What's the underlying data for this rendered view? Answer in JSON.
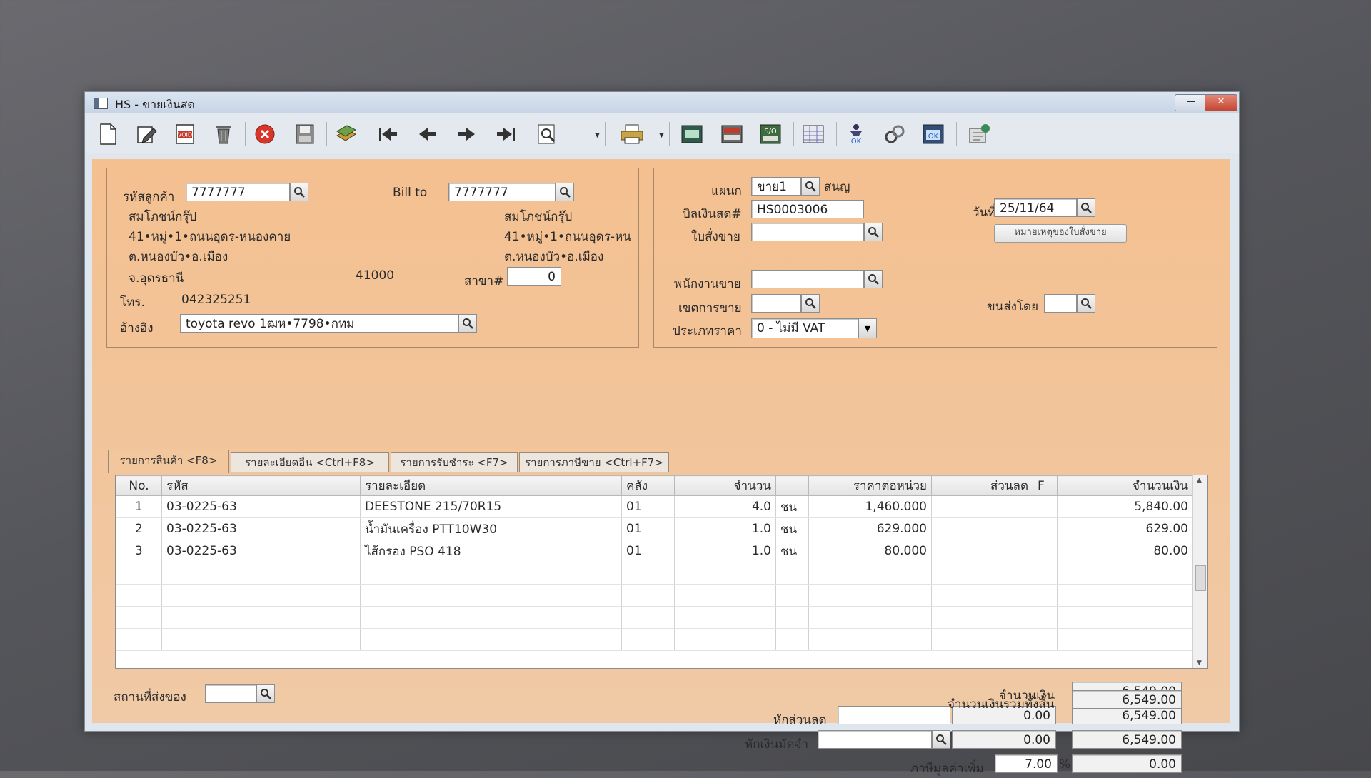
{
  "window": {
    "title": "HS - ขายเงินสด",
    "minimize": "—",
    "maximize": "□",
    "close": "✕"
  },
  "toolbar": {
    "icons": [
      "new-doc-icon",
      "edit-icon",
      "void-icon",
      "delete-trash-icon",
      "cancel-icon",
      "save-icon",
      "copy-icon",
      "first-record-icon",
      "previous-record-icon",
      "next-record-icon",
      "last-record-icon",
      "search-icon",
      "print-icon",
      "report-icon",
      "screen-icon",
      "calc-icon",
      "grid-icon",
      "approve-icon",
      "link-icon",
      "ok-icon",
      "export-icon"
    ]
  },
  "customer": {
    "code_label": "รหัสลูกค้า",
    "code_value": "7777777",
    "billto_label": "Bill to",
    "billto_value": "7777777",
    "name": "สมโภชน์กรุ๊ป",
    "addr1": "41•หมู่•1•ถนนอุดร-หนองคาย",
    "addr2": "ต.หนองบัว•อ.เมือง",
    "addr3": "จ.อุดรธานี",
    "postcode": "41000",
    "billto_name": "สมโภชน์กรุ๊ป",
    "billto_addr1": "41•หมู่•1•ถนนอุดร-หน",
    "billto_addr2": "ต.หนองบัว•อ.เมือง",
    "branch_label": "สาขา#",
    "branch_value": "0",
    "phone_label": "โทร.",
    "phone_value": "042325251",
    "ref_label": "อ้างอิง",
    "ref_value": "toyota revo 1ฒห•7798•กทม"
  },
  "doc": {
    "dept_label": "แผนก",
    "dept_value": "ขาย1",
    "dept_name": "สนญ",
    "bill_label": "บิลเงินสด#",
    "bill_value": "HS0003006",
    "date_label": "วันที่",
    "date_value": "25/11/64",
    "so_label": "ใบสั่งขาย",
    "so_value": "",
    "so_note_button": "หมายเหตุของใบสั่งขาย",
    "salesman_label": "พนักงานขาย",
    "salesman_value": "",
    "area_label": "เขตการขาย",
    "area_value": "",
    "shipby_label": "ขนส่งโดย",
    "shipby_value": "",
    "pricetype_label": "ประเภทราคา",
    "pricetype_value": "0 - ไม่มี VAT"
  },
  "tabs": [
    "รายการสินค้า <F8>",
    "รายละเอียดอื่น <Ctrl+F8>",
    "รายการรับชำระ <F7>",
    "รายการภาษีขาย <Ctrl+F7>"
  ],
  "grid": {
    "headers": [
      "No.",
      "รหัส",
      "รายละเอียด",
      "คลัง",
      "จำนวน",
      "",
      "ราคาต่อหน่วย",
      "ส่วนลด",
      "F",
      "จำนวนเงิน"
    ],
    "rows": [
      [
        "1",
        "03-0225-63",
        "DEESTONE 215/70R15",
        "01",
        "4.0",
        "ชน",
        "1,460.000",
        "",
        "",
        "5,840.00"
      ],
      [
        "2",
        "03-0225-63",
        "น้ำมันเครื่อง PTT10W30",
        "01",
        "1.0",
        "ชน",
        "629.000",
        "",
        "",
        "629.00"
      ],
      [
        "3",
        "03-0225-63",
        "ไส้กรอง PSO 418",
        "01",
        "1.0",
        "ชน",
        "80.000",
        "",
        "",
        "80.00"
      ]
    ]
  },
  "footer": {
    "ship_label": "สถานที่ส่งของ",
    "ship_value": "",
    "amount_label": "จำนวนเงิน",
    "amount_value": "6,549.00",
    "discount_label": "หักส่วนลด",
    "discount_input": "",
    "discount_amount": "0.00",
    "after_discount": "6,549.00",
    "deposit_label": "หักเงินมัดจำ",
    "deposit_input": "",
    "deposit_amount": "0.00",
    "after_deposit": "6,549.00",
    "vat_label": "ภาษีมูลค่าเพิ่ม",
    "vat_rate": "7.00",
    "vat_percent": "%",
    "vat_amount": "0.00",
    "total_label": "จำนวนเงินรวมทั้งสิ้น",
    "total_value": "6,549.00"
  },
  "colors": {
    "form_bg": "#f2c59c",
    "titlebar": "#c6d4e5",
    "close": "#c24530"
  }
}
